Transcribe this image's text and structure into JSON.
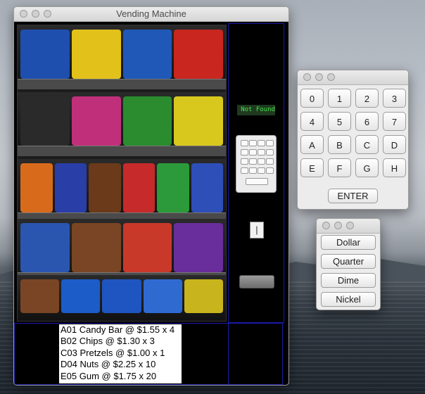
{
  "vending_window": {
    "title": "Vending Machine",
    "display_text": "Not Found",
    "coin_slot_glyph": "|",
    "inventory": [
      "A01 Candy Bar @ $1.55 x 4",
      "B02 Chips @ $1.30 x 3",
      "C03 Pretzels @ $1.00 x 1",
      "D04 Nuts @ $2.25 x 10",
      "E05 Gum @ $1.75 x 20"
    ]
  },
  "keypad_window": {
    "title": "",
    "keys": [
      "0",
      "1",
      "2",
      "3",
      "4",
      "5",
      "6",
      "7",
      "A",
      "B",
      "C",
      "D",
      "E",
      "F",
      "G",
      "H"
    ],
    "enter_label": "ENTER"
  },
  "coin_window": {
    "title": "",
    "coins": [
      "Dollar",
      "Quarter",
      "Dime",
      "Nickel"
    ]
  },
  "colors": {
    "panel_border": "#1a1aa8",
    "display_text": "#49e34d",
    "display_bg": "#1f3a1f"
  }
}
